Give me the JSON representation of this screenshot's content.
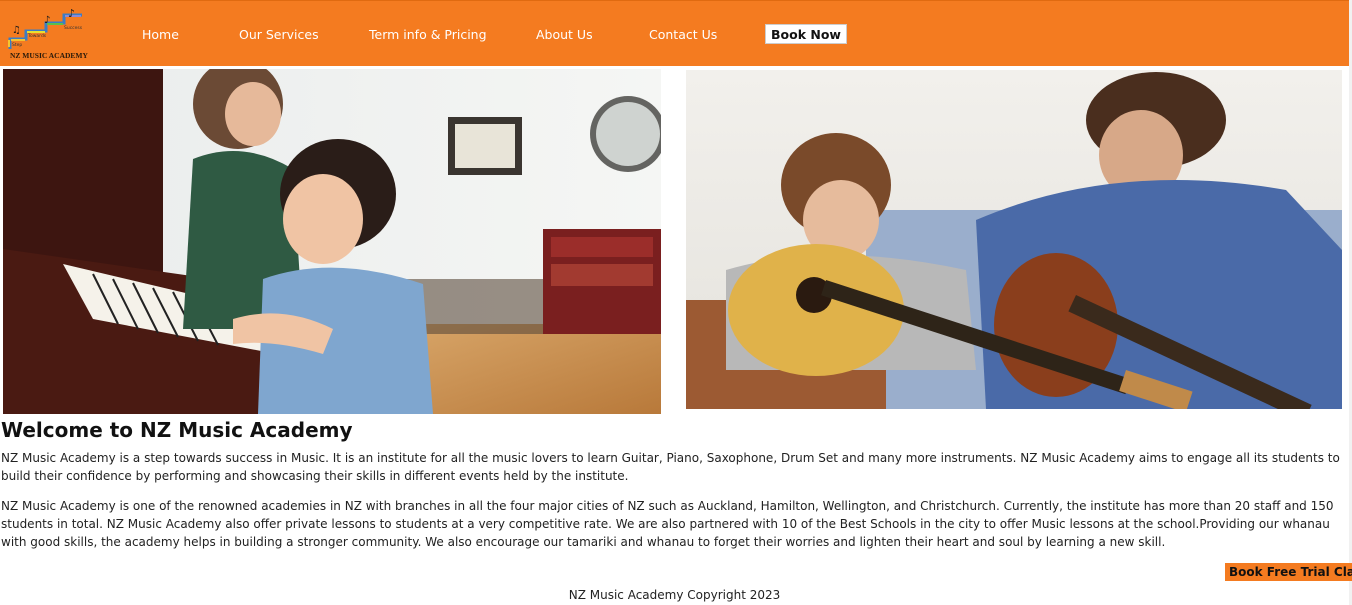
{
  "header": {
    "logo": {
      "name": "NZ MUSIC ACADEMY",
      "steps": [
        "Step",
        "Towards",
        "Success"
      ]
    },
    "nav": [
      {
        "label": "Home"
      },
      {
        "label": "Our Services"
      },
      {
        "label": "Term info & Pricing"
      },
      {
        "label": "About Us"
      },
      {
        "label": "Contact Us"
      }
    ],
    "book_now": "Book Now",
    "accent_color": "#f47b20"
  },
  "hero": {
    "left_image": "piano-lesson-photo",
    "right_image": "guitar-lesson-photo"
  },
  "main": {
    "title": "Welcome to NZ Music Academy",
    "paragraph1": "NZ Music Academy is a step towards success in Music. It is an institute for all the music lovers to learn Guitar, Piano, Saxophone, Drum Set and many more instruments. NZ Music Academy aims to engage all its students to build their confidence by performing and showcasing their skills in different events held by the institute.",
    "paragraph2": "NZ Music Academy is one of the renowned academies in NZ with branches in all the four major cities of NZ such as Auckland, Hamilton, Wellington, and Christchurch. Currently, the institute has more than 20 staff and 150 students in total. NZ Music Academy also offer private lessons to students at a very competitive rate. We are also partnered with 10 of the Best Schools in the city to offer Music lessons at the school.Providing our whanau with good skills, the academy helps in building a stronger community. We also encourage our tamariki and whanau to forget their worries and lighten their heart and soul by learning a new skill."
  },
  "trial_button": "Book Free Trial Class",
  "footer": {
    "copyright": "NZ Music Academy Copyright 2023"
  }
}
